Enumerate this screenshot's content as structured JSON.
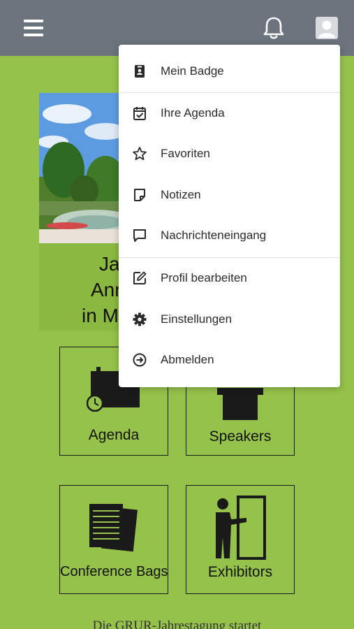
{
  "header": {
    "menu_icon": "hamburger-icon",
    "notification_icon": "bell-icon",
    "profile_icon": "user-avatar-icon"
  },
  "hero": {
    "lines": [
      "Ja",
      "Ann",
      "in Ma"
    ]
  },
  "tiles": [
    {
      "label": "Agenda",
      "icon": "calendar-clock-icon"
    },
    {
      "label": "Speakers",
      "icon": "podium-icon"
    },
    {
      "label": "Conference Bags",
      "icon": "documents-icon"
    },
    {
      "label": "Exhibitors",
      "icon": "exhibitor-door-icon"
    }
  ],
  "bottom_text": "Die GRUR-Jahrestagung startet",
  "user_menu": {
    "items": [
      {
        "label": "Mein Badge",
        "icon": "badge-icon"
      },
      {
        "label": "Ihre Agenda",
        "icon": "calendar-check-icon"
      },
      {
        "label": "Favoriten",
        "icon": "star-icon"
      },
      {
        "label": "Notizen",
        "icon": "note-icon"
      },
      {
        "label": "Nachrichteneingang",
        "icon": "message-icon"
      },
      {
        "label": "Profil bearbeiten",
        "icon": "edit-icon"
      },
      {
        "label": "Einstellungen",
        "icon": "gear-icon"
      },
      {
        "label": "Abmelden",
        "icon": "logout-icon"
      }
    ]
  },
  "colors": {
    "background": "#95c24a",
    "topbar": "#6b747d",
    "menu": "#ffffff"
  }
}
